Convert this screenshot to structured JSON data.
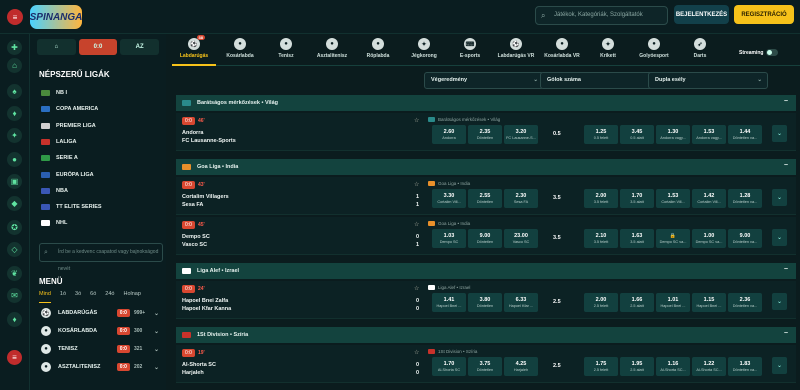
{
  "header": {
    "logo": "SPINANGA",
    "search_placeholder": "Játékok, Kategóriák, Szolgáltatók",
    "login": "BEJELENTKEZÉS",
    "register": "REGISZTRÁCIÓ"
  },
  "sidebar": {
    "tabs": [
      {
        "label": "⌂"
      },
      {
        "label": "0:0"
      },
      {
        "label": "AZ"
      }
    ],
    "popular_title": "NÉPSZERŰ LIGÁK",
    "leagues": [
      {
        "label": "NB I",
        "flag": "#4a8a3c"
      },
      {
        "label": "COPA AMERICA",
        "flag": "#2a6fc2"
      },
      {
        "label": "PREMIER LIGA",
        "flag": "#d0d0d0"
      },
      {
        "label": "LALIGA",
        "flag": "#c8322b"
      },
      {
        "label": "SERIE A",
        "flag": "#2f9a47"
      },
      {
        "label": "EURÓPA LIGA",
        "flag": "#2a5fb0"
      },
      {
        "label": "NBA",
        "flag": "#3a57b6"
      },
      {
        "label": "TT ELITE SERIES",
        "flag": "#3a57b6"
      },
      {
        "label": "NHL",
        "flag": "#ffffff"
      }
    ],
    "search_placeholder": "Írd be a kedvenc csapatod vagy bajnokságod nevét",
    "menu_title": "MENÜ",
    "menu_tabs": [
      "Mind",
      "1ó",
      "3ó",
      "6ó",
      "24ó",
      "Holnap"
    ],
    "sports": [
      {
        "name": "LABDARÚGÁS",
        "count": "999+"
      },
      {
        "name": "KOSÁRLABDA",
        "count": "300"
      },
      {
        "name": "TENISZ",
        "count": "321"
      },
      {
        "name": "ASZTALITENISZ",
        "count": "202"
      }
    ]
  },
  "sports_bar": [
    {
      "label": "Labdarúgás",
      "badge": "38"
    },
    {
      "label": "Kosárlabda",
      "badge": ""
    },
    {
      "label": "Tenisz",
      "badge": ""
    },
    {
      "label": "Asztalitenisz",
      "badge": ""
    },
    {
      "label": "Röplabda",
      "badge": ""
    },
    {
      "label": "Jégkorong",
      "badge": ""
    },
    {
      "label": "E-sports",
      "badge": ""
    },
    {
      "label": "Labdarúgás VR",
      "badge": ""
    },
    {
      "label": "Kosárlabda VR",
      "badge": ""
    },
    {
      "label": "Krikett",
      "badge": ""
    },
    {
      "label": "Golyóesport",
      "badge": ""
    },
    {
      "label": "Darts",
      "badge": ""
    }
  ],
  "streaming_label": "Streaming",
  "filters": [
    "Végeredmény",
    "Gólok száma",
    "Dupla esély"
  ],
  "groups": [
    {
      "title": "Barátságos mérkőzések • Világ",
      "flag": "#2a8a8a",
      "matches": [
        {
          "live": "0:0",
          "minute": "46'",
          "home": "Andorra",
          "away": "FC Lausanne-Sports",
          "score_h": "",
          "score_a": "",
          "bet_title": "Barátságos mérkőzések • Világ",
          "odds": [
            {
              "v": "2.60",
              "l": "Andorra"
            },
            {
              "v": "2.35",
              "l": "Döntetlen"
            },
            {
              "v": "3.20",
              "l": "FC Lausanne-S..."
            }
          ],
          "line": "0.5",
          "goals": [
            {
              "v": "1.25",
              "l": "0.5 felett"
            },
            {
              "v": "3.45",
              "l": "0.5 alatt"
            }
          ],
          "dc": [
            {
              "v": "1.30",
              "l": "Andorra vagy..."
            },
            {
              "v": "1.53",
              "l": "Andorra vagy..."
            },
            {
              "v": "1.44",
              "l": "Döntetlen va..."
            }
          ]
        }
      ]
    },
    {
      "title": "Goa Liga • India",
      "flag": "#e8902b",
      "matches": [
        {
          "live": "0:0",
          "minute": "43'",
          "home": "Cortalim Villagers",
          "away": "Sesa FA",
          "score_h": "1",
          "score_a": "1",
          "bet_title": "Goa Liga • India",
          "odds": [
            {
              "v": "3.30",
              "l": "Cortalim Vill..."
            },
            {
              "v": "2.55",
              "l": "Döntetlen"
            },
            {
              "v": "2.30",
              "l": "Sesa FA"
            }
          ],
          "line": "3.5",
          "goals": [
            {
              "v": "2.00",
              "l": "3.5 felett"
            },
            {
              "v": "1.70",
              "l": "3.5 alatt"
            }
          ],
          "dc": [
            {
              "v": "1.53",
              "l": "Cortalim Vill..."
            },
            {
              "v": "1.42",
              "l": "Cortalim Vill..."
            },
            {
              "v": "1.28",
              "l": "Döntetlen va..."
            }
          ]
        },
        {
          "live": "0:0",
          "minute": "45'",
          "home": "Dempo SC",
          "away": "Vasco SC",
          "score_h": "0",
          "score_a": "1",
          "bet_title": "Goa Liga • India",
          "odds": [
            {
              "v": "1.03",
              "l": "Dempo SC"
            },
            {
              "v": "9.00",
              "l": "Döntetlen"
            },
            {
              "v": "23.00",
              "l": "Vasco SC"
            }
          ],
          "line": "3.5",
          "goals": [
            {
              "v": "2.10",
              "l": "3.5 felett"
            },
            {
              "v": "1.63",
              "l": "3.5 alatt"
            }
          ],
          "dc": [
            {
              "v": "",
              "l": "Dempo SC va..."
            },
            {
              "v": "1.00",
              "l": "Dempo SC va..."
            },
            {
              "v": "9.00",
              "l": "Döntetlen va..."
            }
          ]
        }
      ]
    },
    {
      "title": "Liga Alef • Izrael",
      "flag": "#ffffff",
      "matches": [
        {
          "live": "0:0",
          "minute": "24'",
          "home": "Hapoel Bnei Zalfa",
          "away": "Hapoel Kfar Kanna",
          "score_h": "0",
          "score_a": "0",
          "bet_title": "Liga Alef • Izrael",
          "odds": [
            {
              "v": "1.41",
              "l": "Hapoel Bnei ..."
            },
            {
              "v": "3.80",
              "l": "Döntetlen"
            },
            {
              "v": "6.33",
              "l": "Hapoel Kfar ..."
            }
          ],
          "line": "2.5",
          "goals": [
            {
              "v": "2.00",
              "l": "2.5 felett"
            },
            {
              "v": "1.66",
              "l": "2.5 alatt"
            }
          ],
          "dc": [
            {
              "v": "1.01",
              "l": "Hapoel Bnei ..."
            },
            {
              "v": "1.15",
              "l": "Hapoel Bnei ..."
            },
            {
              "v": "2.36",
              "l": "Döntetlen va..."
            }
          ]
        }
      ]
    },
    {
      "title": "1St Division • Szíria",
      "flag": "#c8322b",
      "matches": [
        {
          "live": "0:0",
          "minute": "19'",
          "home": "Al-Shorta SC",
          "away": "Harjaleh",
          "score_h": "0",
          "score_a": "0",
          "bet_title": "1St Division • Szíria",
          "odds": [
            {
              "v": "1.70",
              "l": "Al-Shorta SC"
            },
            {
              "v": "3.75",
              "l": "Döntetlen"
            },
            {
              "v": "4.25",
              "l": "Harjaleh"
            }
          ],
          "line": "2.5",
          "goals": [
            {
              "v": "1.75",
              "l": "2.5 felett"
            },
            {
              "v": "1.95",
              "l": "2.5 alatt"
            }
          ],
          "dc": [
            {
              "v": "1.16",
              "l": "Al-Shorta SC..."
            },
            {
              "v": "1.22",
              "l": "Al-Shorta SC..."
            },
            {
              "v": "1.83",
              "l": "Döntetlen va..."
            }
          ]
        }
      ]
    }
  ]
}
